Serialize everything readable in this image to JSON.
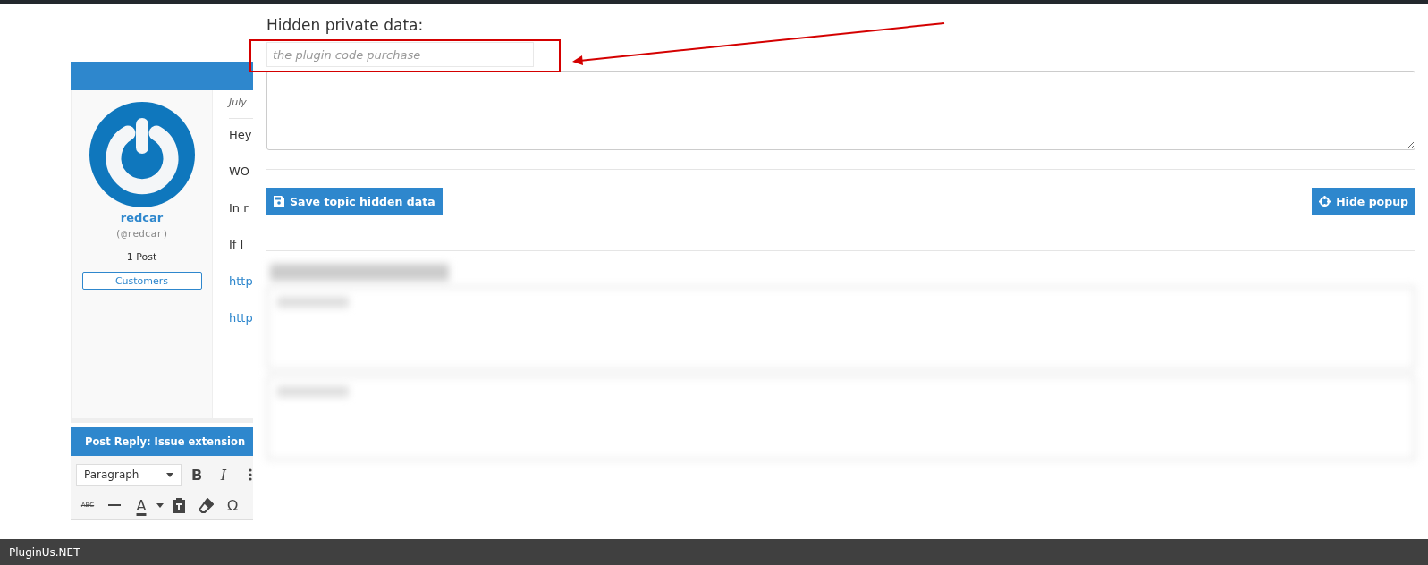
{
  "post": {
    "author": {
      "name": "redcar",
      "handle": "(@redcar)",
      "posts": "1 Post",
      "role": "Customers"
    },
    "date": "July",
    "lines": [
      {
        "kind": "text",
        "text": "Hey"
      },
      {
        "kind": "text",
        "text": "WO"
      },
      {
        "kind": "text",
        "text": "In r"
      },
      {
        "kind": "text",
        "text": "If I"
      },
      {
        "kind": "link",
        "text": "http"
      },
      {
        "kind": "link",
        "text": "http"
      }
    ]
  },
  "reply": {
    "title": "Post Reply: Issue extension",
    "format_select": "Paragraph",
    "toolbar_rows": [
      [
        {
          "kind": "bold",
          "label": "B"
        },
        {
          "kind": "italic",
          "label": "I"
        },
        {
          "kind": "list"
        }
      ],
      [
        {
          "kind": "strike",
          "label": "ABC"
        },
        {
          "kind": "hr"
        },
        {
          "kind": "color",
          "label": "A"
        },
        {
          "kind": "paste"
        },
        {
          "kind": "eraser"
        },
        {
          "kind": "char",
          "label": "Ω"
        }
      ]
    ]
  },
  "popup": {
    "heading": "Hidden private data:",
    "input": {
      "placeholder": "the plugin code purchase"
    },
    "save_button": "Save topic hidden data",
    "hide_button": "Hide popup"
  },
  "footer": {
    "brand": "PluginUs.NET"
  }
}
